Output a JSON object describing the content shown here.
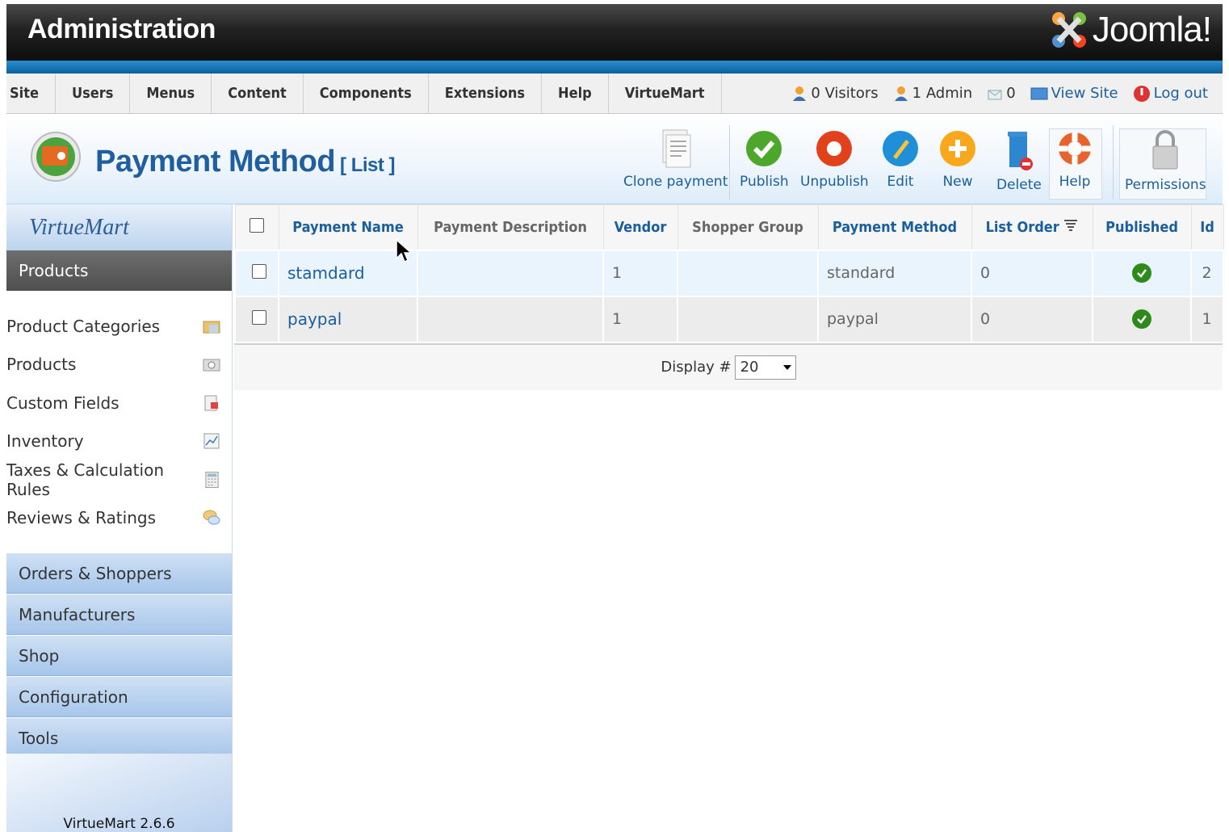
{
  "header": {
    "title": "Administration",
    "logo_text": "Joomla!"
  },
  "menu": [
    "Site",
    "Users",
    "Menus",
    "Content",
    "Components",
    "Extensions",
    "Help",
    "VirtueMart"
  ],
  "status": {
    "visitors": "0 Visitors",
    "admins": "1 Admin",
    "messages": "0",
    "view_site": "View Site",
    "logout": "Log out"
  },
  "page": {
    "title": "Payment Method",
    "subtitle": "[ List ]"
  },
  "toolbar": {
    "clone": "Clone payment",
    "publish": "Publish",
    "unpublish": "Unpublish",
    "edit": "Edit",
    "new": "New",
    "delete": "Delete",
    "help": "Help",
    "permissions": "Permissions"
  },
  "sidebar": {
    "logo": "VirtueMart",
    "active": "Products",
    "items": [
      "Product Categories",
      "Products",
      "Custom Fields",
      "Inventory",
      "Taxes & Calculation Rules",
      "Reviews & Ratings"
    ],
    "categories": [
      "Orders & Shoppers",
      "Manufacturers",
      "Shop",
      "Configuration",
      "Tools"
    ],
    "version": "VirtueMart 2.6.6"
  },
  "table": {
    "columns": [
      "Payment Name",
      "Payment Description",
      "Vendor",
      "Shopper Group",
      "Payment Method",
      "List Order",
      "Published",
      "Id"
    ],
    "rows": [
      {
        "name": "stamdard",
        "description": "",
        "vendor": "1",
        "shopper_group": "",
        "method": "standard",
        "order": "0",
        "published": true,
        "id": "2"
      },
      {
        "name": "paypal",
        "description": "",
        "vendor": "1",
        "shopper_group": "",
        "method": "paypal",
        "order": "0",
        "published": true,
        "id": "1"
      }
    ],
    "display_label": "Display #",
    "display_value": "20"
  },
  "colors": {
    "accent": "#1a5f9d",
    "header_bg": "#1a1a1a",
    "blue_bar": "#1b78b8",
    "published": "#2f8a1c"
  }
}
